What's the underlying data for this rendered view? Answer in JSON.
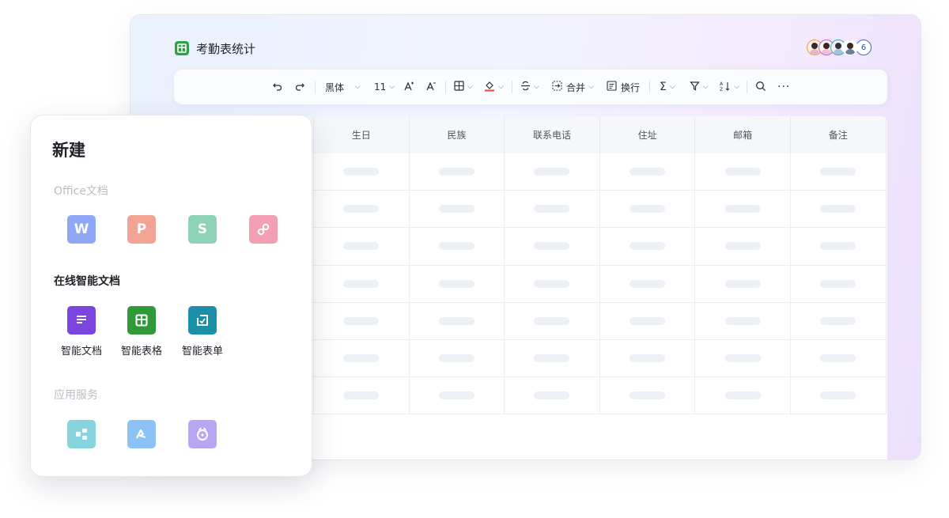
{
  "document": {
    "title": "考勤表统计",
    "collaborator_count": "6"
  },
  "toolbar": {
    "undo_icon": "undo-icon",
    "redo_icon": "redo-icon",
    "font_name": "黑体",
    "font_size": "11",
    "merge_label": "合并",
    "wrap_label": "换行"
  },
  "sheet": {
    "columns": [
      "生日",
      "民族",
      "联系电话",
      "住址",
      "邮箱",
      "备注"
    ],
    "row_count": 7
  },
  "new_panel": {
    "title": "新建",
    "sections": {
      "office": {
        "label": "Office文档",
        "items": [
          {
            "name": "word-icon",
            "glyph": "W",
            "color": "#8fa7f5"
          },
          {
            "name": "presentation-icon",
            "glyph": "P",
            "color": "#f2a394"
          },
          {
            "name": "spreadsheet-icon",
            "glyph": "S",
            "color": "#8ed2b8"
          },
          {
            "name": "pdf-icon",
            "glyph": "",
            "color": "#f29eb3"
          }
        ]
      },
      "smart": {
        "label": "在线智能文档",
        "items": [
          {
            "name": "smart-doc-icon",
            "label": "智能文档",
            "color": "#7b45e0"
          },
          {
            "name": "smart-sheet-icon",
            "label": "智能表格",
            "color": "#2f9a3a"
          },
          {
            "name": "smart-form-icon",
            "label": "智能表单",
            "color": "#1b8ea8"
          }
        ]
      },
      "apps": {
        "label": "应用服务",
        "items": [
          {
            "name": "app-flow-icon",
            "color": "#86d4dd"
          },
          {
            "name": "app-sign-icon",
            "color": "#8cc2f5"
          },
          {
            "name": "app-mascot-icon",
            "color": "#b8a6f5"
          }
        ]
      }
    }
  },
  "colors": {
    "brand_green": "#2fa048",
    "accent_blue": "#3e6bd9"
  }
}
